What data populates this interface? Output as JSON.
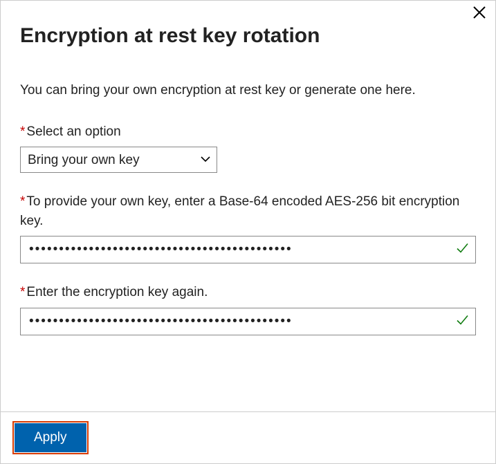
{
  "dialog": {
    "title": "Encryption at rest key rotation",
    "description": "You can bring your own encryption at rest key or generate one here."
  },
  "fields": {
    "select_option": {
      "label": "Select an option",
      "value": "Bring your own key"
    },
    "key_input": {
      "label": "To provide your own key, enter a Base-64 encoded AES-256 bit encryption key.",
      "value": "••••••••••••••••••••••••••••••••••••••••••••"
    },
    "key_confirm": {
      "label": "Enter the encryption key again.",
      "value": "••••••••••••••••••••••••••••••••••••••••••••"
    }
  },
  "footer": {
    "apply_label": "Apply"
  },
  "required_marker": "*"
}
